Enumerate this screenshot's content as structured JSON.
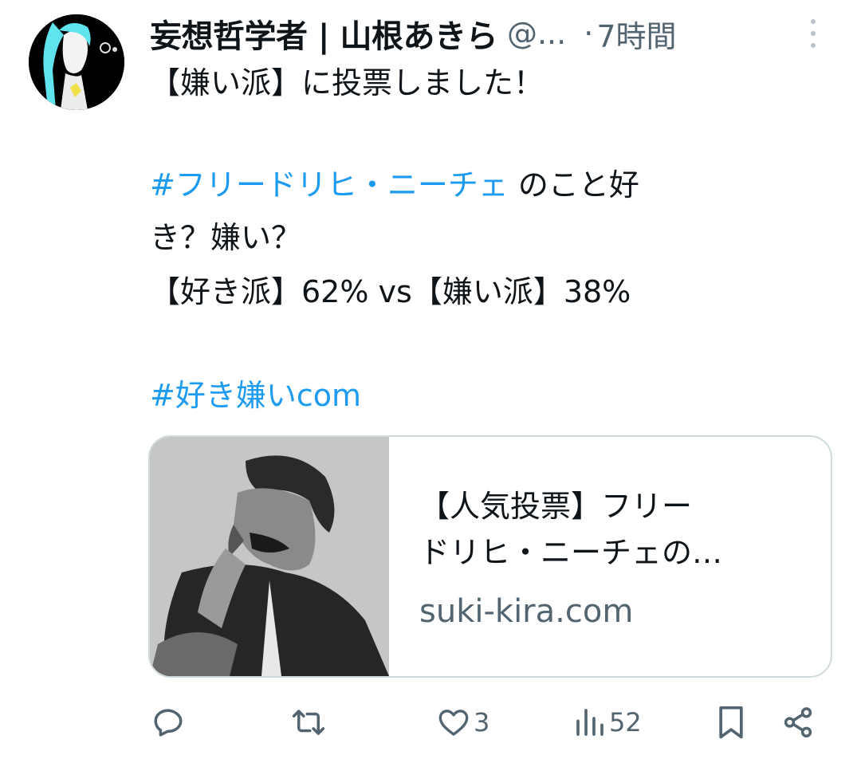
{
  "tweet": {
    "display_name": "妄想哲学者 | 山根あきら",
    "handle": "@...",
    "separator": "·",
    "time": "7時間",
    "line1": "【嫌い派】に投票しました！",
    "hashtag1": "#フリードリヒ・ニーチェ",
    "line2_rest": " のこと好",
    "line3": "き？嫌い？",
    "line4": "【好き派】62% vs【嫌い派】38%",
    "hashtag2": "#好き嫌いcom"
  },
  "card": {
    "title_line1": "【人気投票】フリー",
    "title_line2": "ドリヒ・ニーチェの…",
    "domain": "suki-kira.com"
  },
  "actions": {
    "like_count": "3",
    "views_count": "52"
  },
  "icons": {
    "reply": "reply-icon",
    "retweet": "retweet-icon",
    "like": "heart-icon",
    "views": "views-icon",
    "bookmark": "bookmark-icon",
    "share": "share-icon"
  },
  "colors": {
    "link": "#1d9bf0",
    "secondary_text": "#536471",
    "card_border": "#cfd9de"
  }
}
